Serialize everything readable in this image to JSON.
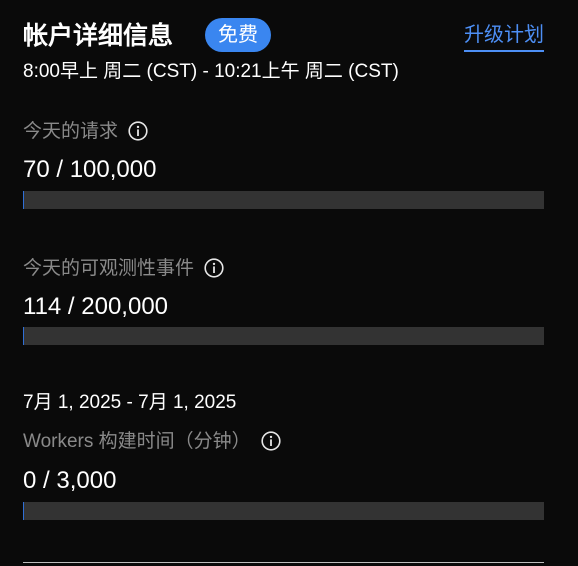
{
  "account": {
    "title": "帐户详细信息",
    "plan_badge": "免费",
    "upgrade_link": "升级计划",
    "period": "8:00早上 周二 (CST) - 10:21上午 周二 (CST)"
  },
  "metrics": [
    {
      "label": "今天的请求",
      "value_text": "70 / 100,000",
      "used": 70,
      "limit": 100000
    },
    {
      "label": "今天的可观测性事件",
      "value_text": "114 / 200,000",
      "used": 114,
      "limit": 200000
    },
    {
      "label": "Workers 构建时间（分钟）",
      "value_text": "0 / 3,000",
      "used": 0,
      "limit": 3000
    }
  ],
  "build_period": "7月 1, 2025 - 7月 1, 2025",
  "icons": {
    "info": "info-circle-icon"
  },
  "colors": {
    "background": "#0a0a0a",
    "accent": "#3a86f0",
    "link": "#4d8ff5",
    "muted_text": "#8a8a8a",
    "bar_track": "#333333",
    "bar_fill": "#2f6fd6"
  }
}
